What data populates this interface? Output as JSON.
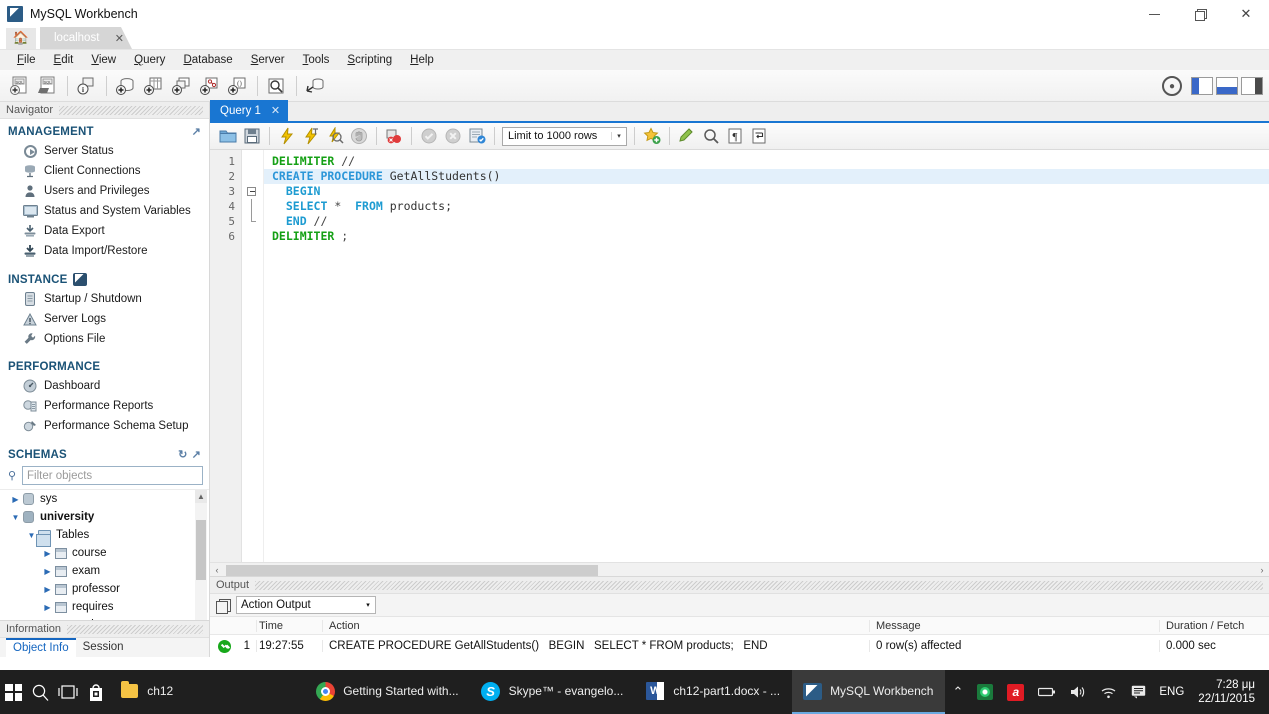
{
  "window": {
    "title": "MySQL Workbench",
    "app_icon": "mysql-workbench-icon",
    "minimize": "—",
    "maximize": "❐",
    "close": "✕"
  },
  "connection_tabs": {
    "home_icon": "home-icon",
    "tabs": [
      {
        "label": "localhost",
        "close": "✕"
      }
    ]
  },
  "menubar": {
    "items": [
      {
        "label": "File",
        "accel": "F"
      },
      {
        "label": "Edit",
        "accel": "E"
      },
      {
        "label": "View",
        "accel": "V"
      },
      {
        "label": "Query",
        "accel": "Q"
      },
      {
        "label": "Database",
        "accel": "D"
      },
      {
        "label": "Server",
        "accel": "S"
      },
      {
        "label": "Tools",
        "accel": "T"
      },
      {
        "label": "Scripting",
        "accel": "S"
      },
      {
        "label": "Help",
        "accel": "H"
      }
    ]
  },
  "main_toolbar": {
    "buttons": [
      {
        "name": "new-sql-tab-icon",
        "glyph": "SQL"
      },
      {
        "name": "open-sql-script-icon",
        "glyph": "SQL"
      },
      {
        "name": "connection-info-icon",
        "glyph": "i"
      },
      {
        "name": "create-new-schema-icon",
        "glyph": "+"
      },
      {
        "name": "create-new-table-icon",
        "glyph": "+"
      },
      {
        "name": "create-new-view-icon",
        "glyph": "+"
      },
      {
        "name": "create-new-procedure-icon",
        "glyph": "+"
      },
      {
        "name": "create-new-function-icon",
        "glyph": "+"
      },
      {
        "name": "search-data-icon",
        "glyph": "Q"
      },
      {
        "name": "reconnect-to-server-icon",
        "glyph": "R"
      }
    ],
    "right": {
      "account_icon": "account-icon",
      "panel_toggles": [
        {
          "name": "toggle-sidebar-button"
        },
        {
          "name": "toggle-output-button"
        },
        {
          "name": "toggle-secondary-sidebar-button"
        }
      ]
    }
  },
  "navigator": {
    "caption": "Navigator",
    "sections": [
      {
        "title": "MANAGEMENT",
        "expand_icon": "expand-icon",
        "items": [
          {
            "label": "Server Status",
            "icon": "server-status-icon"
          },
          {
            "label": "Client Connections",
            "icon": "client-connections-icon"
          },
          {
            "label": "Users and Privileges",
            "icon": "users-privileges-icon"
          },
          {
            "label": "Status and System Variables",
            "icon": "status-variables-icon"
          },
          {
            "label": "Data Export",
            "icon": "data-export-icon"
          },
          {
            "label": "Data Import/Restore",
            "icon": "data-import-icon"
          }
        ]
      },
      {
        "title": "INSTANCE",
        "badge_icon": "instance-badge-icon",
        "items": [
          {
            "label": "Startup / Shutdown",
            "icon": "startup-shutdown-icon"
          },
          {
            "label": "Server Logs",
            "icon": "server-logs-icon"
          },
          {
            "label": "Options File",
            "icon": "options-file-icon"
          }
        ]
      },
      {
        "title": "PERFORMANCE",
        "items": [
          {
            "label": "Dashboard",
            "icon": "dashboard-icon"
          },
          {
            "label": "Performance Reports",
            "icon": "performance-reports-icon"
          },
          {
            "label": "Performance Schema Setup",
            "icon": "performance-schema-setup-icon"
          }
        ]
      }
    ],
    "schemas": {
      "title": "SCHEMAS",
      "refresh_icon": "refresh-icon",
      "expand_icon": "expand-icon",
      "filter_placeholder": "Filter objects",
      "filter_value": "",
      "search_icon": "search-icon",
      "tree": [
        {
          "label": "sys",
          "depth": 0,
          "expanded": false,
          "icon": "schema-icon",
          "bold": false
        },
        {
          "label": "university",
          "depth": 0,
          "expanded": true,
          "icon": "schema-icon",
          "bold": true
        },
        {
          "label": "Tables",
          "depth": 1,
          "expanded": true,
          "icon": "tables-folder-icon",
          "bold": false
        },
        {
          "label": "course",
          "depth": 2,
          "expanded": false,
          "icon": "table-icon",
          "bold": false
        },
        {
          "label": "exam",
          "depth": 2,
          "expanded": false,
          "icon": "table-icon",
          "bold": false
        },
        {
          "label": "professor",
          "depth": 2,
          "expanded": false,
          "icon": "table-icon",
          "bold": false
        },
        {
          "label": "requires",
          "depth": 2,
          "expanded": false,
          "icon": "table-icon",
          "bold": false
        },
        {
          "label": "student",
          "depth": 2,
          "expanded": false,
          "icon": "table-icon",
          "bold": false
        }
      ]
    },
    "information": {
      "caption": "Information",
      "tabs": [
        {
          "label": "Object Info",
          "selected": true
        },
        {
          "label": "Session",
          "selected": false
        }
      ]
    }
  },
  "editor": {
    "tabs": [
      {
        "label": "Query 1",
        "close": "✕",
        "selected": true
      }
    ],
    "toolbar": {
      "buttons": [
        {
          "name": "open-script-icon"
        },
        {
          "name": "save-script-icon"
        },
        {
          "name": "execute-statement-icon"
        },
        {
          "name": "execute-current-statement-icon"
        },
        {
          "name": "explain-statement-icon"
        },
        {
          "name": "stop-execution-icon"
        },
        {
          "name": "toggle-stop-on-error-icon"
        },
        {
          "name": "commit-transaction-icon"
        },
        {
          "name": "rollback-transaction-icon"
        },
        {
          "name": "toggle-autocommit-icon"
        },
        {
          "name": "beautify-sql-icon"
        },
        {
          "name": "find-icon"
        },
        {
          "name": "toggle-invisible-characters-icon"
        },
        {
          "name": "toggle-word-wrap-icon"
        }
      ],
      "limit_label": "Limit to 1000 rows",
      "limit_arrow": "▾"
    },
    "code": {
      "lines": [
        {
          "n": "1",
          "breakpoint": false,
          "fold": "none",
          "tokens": [
            {
              "t": "DELIMITER",
              "c": "kw"
            },
            {
              "t": " //",
              "c": "op"
            }
          ]
        },
        {
          "n": "2",
          "breakpoint": true,
          "fold": "none",
          "highlight": true,
          "tokens": [
            {
              "t": "CREATE PROCEDURE",
              "c": "kw2"
            },
            {
              "t": " GetAllStudents()",
              "c": "idt"
            }
          ]
        },
        {
          "n": "3",
          "breakpoint": false,
          "fold": "start",
          "tokens": [
            {
              "t": "  BEGIN",
              "c": "kw3"
            }
          ]
        },
        {
          "n": "4",
          "breakpoint": false,
          "fold": "mid",
          "tokens": [
            {
              "t": "  SELECT",
              "c": "kw3"
            },
            {
              "t": " * ",
              "c": "op"
            },
            {
              "t": " FROM",
              "c": "kw3"
            },
            {
              "t": " products;",
              "c": "idt"
            }
          ]
        },
        {
          "n": "5",
          "breakpoint": false,
          "fold": "end",
          "tokens": [
            {
              "t": "  END",
              "c": "kw3"
            },
            {
              "t": " //",
              "c": "op"
            }
          ]
        },
        {
          "n": "6",
          "breakpoint": false,
          "fold": "none",
          "tokens": [
            {
              "t": "DELIMITER",
              "c": "kw"
            },
            {
              "t": " ;",
              "c": "op"
            }
          ]
        }
      ]
    },
    "hscroll": {
      "left_arrow": "‹",
      "right_arrow": "›"
    }
  },
  "output": {
    "caption": "Output",
    "stack_icon": "output-stack-icon",
    "selector_value": "Action Output",
    "selector_arrow": "▾",
    "columns": {
      "status": "",
      "num": "",
      "time": "Time",
      "action": "Action",
      "message": "Message",
      "duration": "Duration / Fetch"
    },
    "rows": [
      {
        "status": "success",
        "num": "1",
        "time": "19:27:55",
        "action": "CREATE PROCEDURE GetAllStudents()   BEGIN   SELECT * FROM products;   END",
        "message": "0 row(s) affected",
        "duration": "0.000 sec"
      }
    ]
  },
  "taskbar": {
    "start_icon": "windows-start-icon",
    "search_icon": "search-icon",
    "taskview_icon": "task-view-icon",
    "store_icon": "microsoft-store-icon",
    "apps": [
      {
        "label": "ch12",
        "icon": "folder-icon",
        "active": false
      },
      {
        "label": "Getting Started with...",
        "icon": "chrome-icon",
        "active": false
      },
      {
        "label": "Skype™ - evangelo...",
        "icon": "skype-icon",
        "active": false
      },
      {
        "label": "ch12-part1.docx - ...",
        "icon": "word-icon",
        "active": false
      },
      {
        "label": "MySQL Workbench",
        "icon": "mysql-workbench-icon",
        "active": true
      }
    ],
    "tray": {
      "chevron": "⌃",
      "icons": [
        {
          "name": "dropbox-tray-icon"
        },
        {
          "name": "avast-tray-icon",
          "glyph": "a"
        },
        {
          "name": "battery-tray-icon",
          "glyph": "▭"
        },
        {
          "name": "volume-tray-icon",
          "glyph": "◁"
        },
        {
          "name": "wifi-tray-icon",
          "glyph": "◗"
        },
        {
          "name": "action-center-icon",
          "glyph": "▤"
        }
      ],
      "language": "ENG",
      "time": "7:28 μμ",
      "date": "22/11/2015"
    }
  },
  "colors": {
    "accent_blue": "#1976d2",
    "keyword_green": "#15a015",
    "keyword_blue": "#2b96d8",
    "section_header": "#1a5276",
    "success_green": "#17a81a"
  }
}
